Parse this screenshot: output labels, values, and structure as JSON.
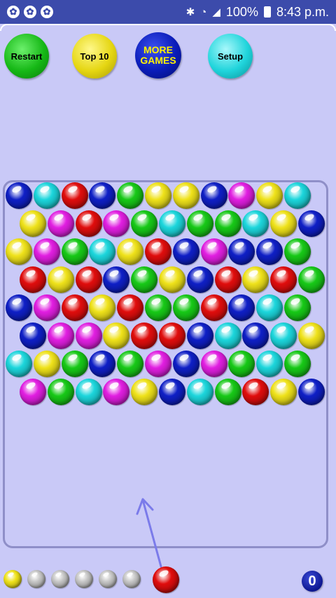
{
  "status_bar": {
    "battery": "100%",
    "time": "8:43 p.m.",
    "icons": [
      "bluetooth-icon",
      "wifi-icon",
      "signal-icon",
      "battery-icon"
    ],
    "notification_icons": [
      "notification-icon",
      "notification-icon",
      "notification-icon"
    ]
  },
  "menu": {
    "restart": "Restart",
    "top10": "Top 10",
    "more_games": "MORE GAMES",
    "setup": "Setup"
  },
  "colors": {
    "blue": "#0f1fc6",
    "cyan": "#1cd6dc",
    "red": "#e00d0d",
    "green": "#17c917",
    "yellow": "#efe21a",
    "magenta": "#e11ee1",
    "gray": "#c5c5c5"
  },
  "grid": [
    [
      "blue",
      "cyan",
      "red",
      "blue",
      "green",
      "yellow",
      "yellow",
      "blue",
      "magenta",
      "yellow",
      "cyan"
    ],
    [
      "yellow",
      "magenta",
      "red",
      "magenta",
      "green",
      "cyan",
      "green",
      "green",
      "cyan",
      "yellow",
      "blue"
    ],
    [
      "yellow",
      "magenta",
      "green",
      "cyan",
      "yellow",
      "red",
      "blue",
      "magenta",
      "blue",
      "blue",
      "green"
    ],
    [
      "red",
      "yellow",
      "red",
      "blue",
      "green",
      "yellow",
      "blue",
      "red",
      "yellow",
      "red",
      "green"
    ],
    [
      "blue",
      "magenta",
      "red",
      "yellow",
      "red",
      "green",
      "green",
      "red",
      "blue",
      "cyan",
      "green"
    ],
    [
      "blue",
      "magenta",
      "magenta",
      "yellow",
      "red",
      "red",
      "blue",
      "cyan",
      "blue",
      "cyan",
      "yellow"
    ],
    [
      "cyan",
      "yellow",
      "green",
      "blue",
      "green",
      "magenta",
      "blue",
      "magenta",
      "green",
      "cyan",
      "green"
    ],
    [
      "magenta",
      "green",
      "cyan",
      "magenta",
      "yellow",
      "blue",
      "cyan",
      "green",
      "red",
      "yellow",
      "blue"
    ]
  ],
  "queue": [
    "yellow",
    "gray",
    "gray",
    "gray",
    "gray",
    "gray"
  ],
  "current_ball": "red",
  "score": "0"
}
